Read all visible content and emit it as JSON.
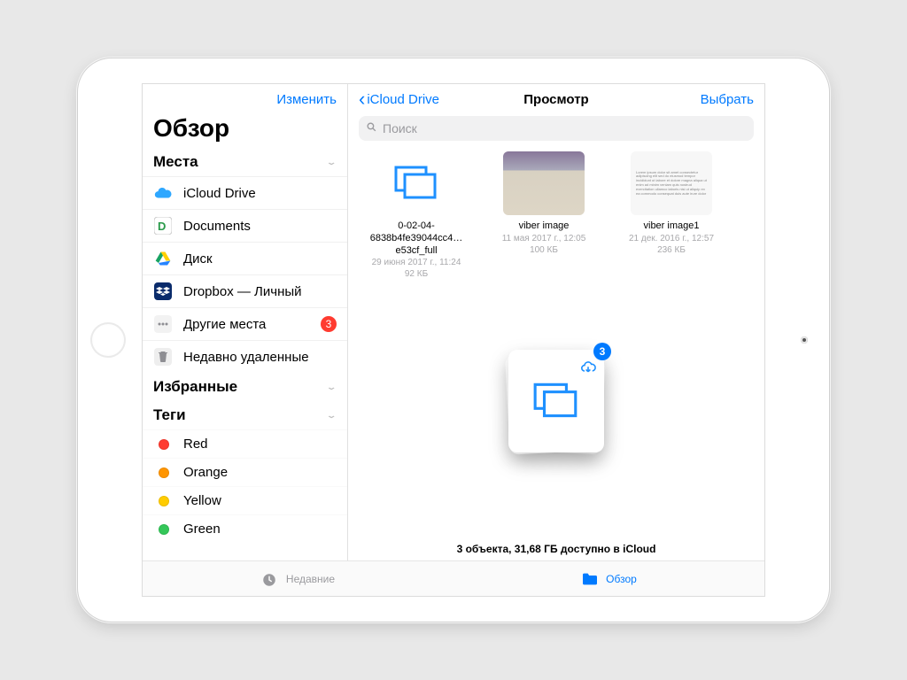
{
  "sidebar": {
    "edit": "Изменить",
    "title": "Обзор",
    "locations_header": "Места",
    "favorites_header": "Избранные",
    "tags_header": "Теги",
    "items": [
      {
        "label": "iCloud Drive"
      },
      {
        "label": "Documents"
      },
      {
        "label": "Диск"
      },
      {
        "label": "Dropbox — Личный"
      },
      {
        "label": "Другие места",
        "badge": "3"
      },
      {
        "label": "Недавно удаленные"
      }
    ],
    "tags": [
      {
        "label": "Red",
        "color": "#ff3b30"
      },
      {
        "label": "Orange",
        "color": "#ff9500"
      },
      {
        "label": "Yellow",
        "color": "#ffcc00"
      },
      {
        "label": "Green",
        "color": "#34c759"
      }
    ]
  },
  "main": {
    "back": "iCloud Drive",
    "title": "Просмотр",
    "select": "Выбрать",
    "search_placeholder": "Поиск",
    "download_badge": "3",
    "footer": "3 объекта, 31,68 ГБ доступно в iCloud",
    "files": [
      {
        "name": "0-02-04-6838b4fe39044cc4…e53cf_full",
        "date": "29 июня 2017 г., 11:24",
        "size": "92 КБ"
      },
      {
        "name": "viber image",
        "date": "11 мая 2017 г., 12:05",
        "size": "100 КБ"
      },
      {
        "name": "viber image1",
        "date": "21 дек. 2016 г., 12:57",
        "size": "236 КБ"
      }
    ]
  },
  "tabbar": {
    "recent": "Недавние",
    "browse": "Обзор"
  }
}
